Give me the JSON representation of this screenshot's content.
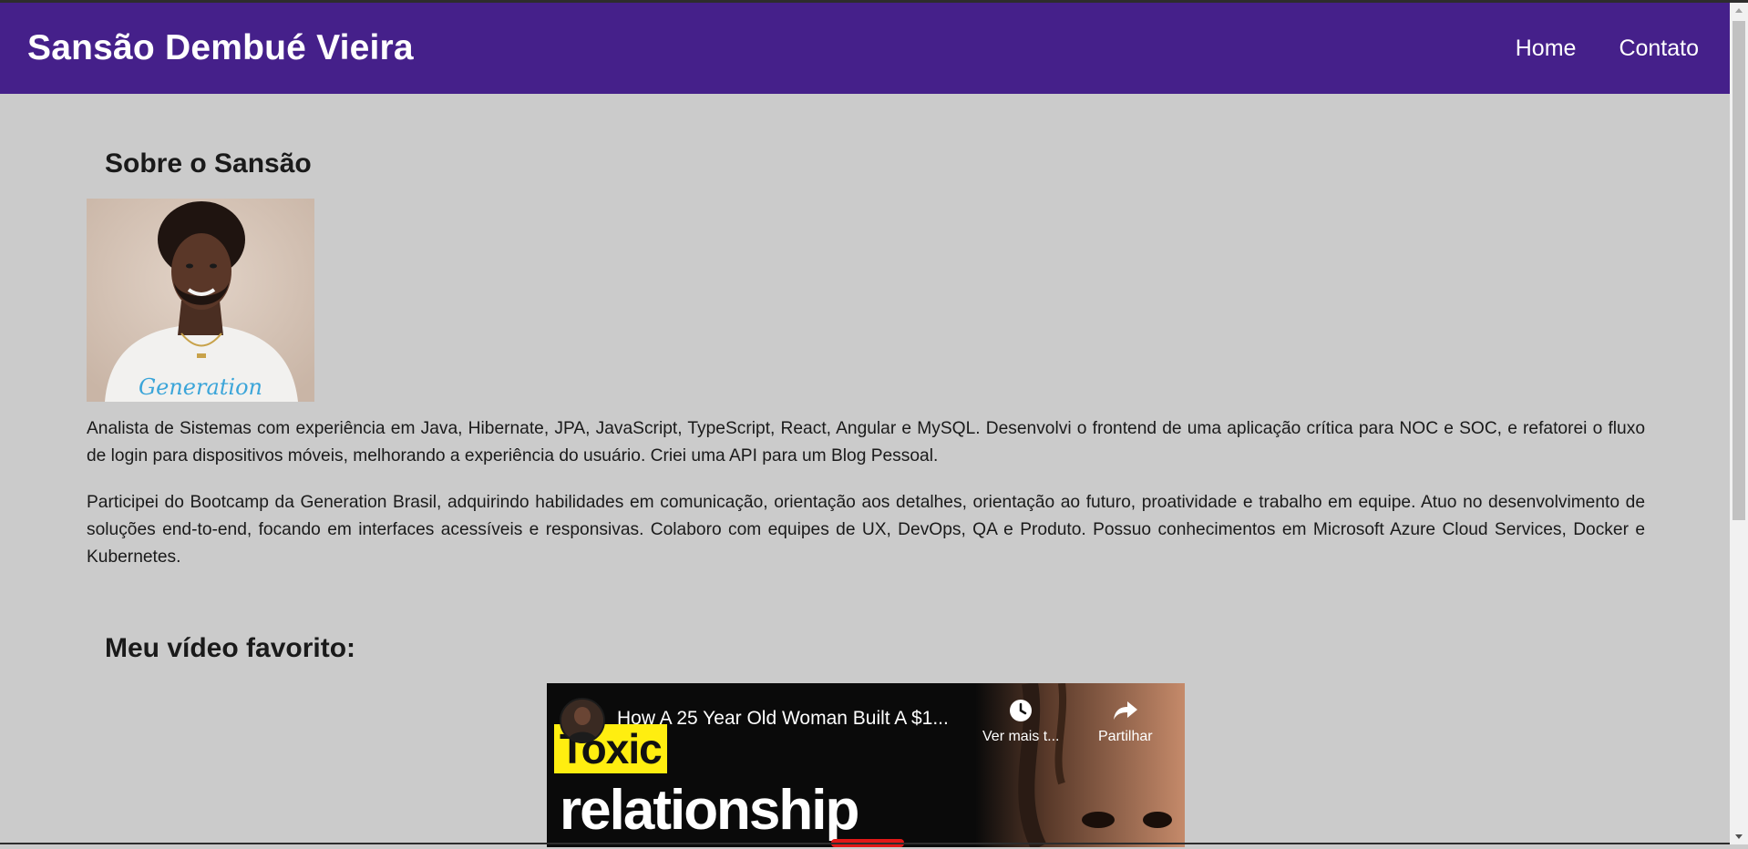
{
  "header": {
    "brand": "Sansão Dembué Vieira",
    "nav": [
      {
        "label": "Home"
      },
      {
        "label": "Contato"
      }
    ]
  },
  "about": {
    "title": "Sobre o Sansão",
    "photo_shirt_text": "Generation",
    "paragraphs": [
      "Analista de Sistemas com experiência em Java, Hibernate, JPA, JavaScript, TypeScript, React, Angular e MySQL. Desenvolvi o frontend de uma aplicação crítica para NOC e SOC, e refatorei o fluxo de login para dispositivos móveis, melhorando a experiência do usuário. Criei uma API para um Blog Pessoal.",
      "Participei do Bootcamp da Generation Brasil, adquirindo habilidades em comunicação, orientação aos detalhes, orientação ao futuro, proatividade e trabalho em equipe. Atuo no desenvolvimento de soluções end-to-end, focando em interfaces acessíveis e responsivas. Colaboro com equipes de UX, DevOps, QA e Produto. Possuo conhecimentos em Microsoft Azure Cloud Services, Docker e Kubernetes."
    ]
  },
  "video": {
    "section_title": "Meu vídeo favorito:",
    "title": "How A 25 Year Old Woman Built A $1...",
    "watch_later_label": "Ver mais t...",
    "share_label": "Partilhar",
    "thumbnail_text_1": "Toxic",
    "thumbnail_text_2": "relationship"
  },
  "colors": {
    "navbar": "#45208a",
    "page_background": "#cbcbcb"
  }
}
